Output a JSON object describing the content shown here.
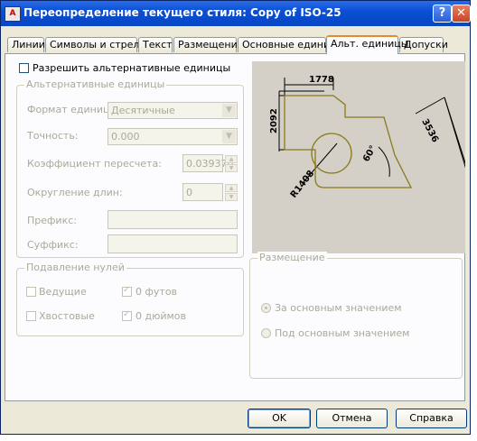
{
  "window": {
    "title": "Переопределение текущего стиля: Copy of ISO-25",
    "help_label": "?",
    "close_label": "✕"
  },
  "tabs": [
    {
      "label": "Линии",
      "active": false
    },
    {
      "label": "Символы и стрелки",
      "active": false
    },
    {
      "label": "Текст",
      "active": false
    },
    {
      "label": "Размещение",
      "active": false
    },
    {
      "label": "Основные единицы",
      "active": false
    },
    {
      "label": "Альт. единицы",
      "active": true
    },
    {
      "label": "Допуски",
      "active": false
    }
  ],
  "enable_alt": {
    "label": "Разрешить альтернативные единицы",
    "checked": false
  },
  "alt_units": {
    "title": "Альтернативные единицы",
    "format_label": "Формат единиц:",
    "format_value": "Десятичные",
    "precision_label": "Точность:",
    "precision_value": "0.000",
    "multiplier_label": "Коэффициент пересчета:",
    "multiplier_value": "0.039370",
    "round_label": "Округление длин:",
    "round_value": "0",
    "prefix_label": "Префикс:",
    "prefix_value": "",
    "suffix_label": "Суффикс:",
    "suffix_value": ""
  },
  "zero_suppression": {
    "title": "Подавление нулей",
    "leading": {
      "label": "Ведущие",
      "checked": false
    },
    "trailing": {
      "label": "Хвостовые",
      "checked": false
    },
    "feet": {
      "label": "0 футов",
      "checked": true
    },
    "inches": {
      "label": "0 дюймов",
      "checked": true
    }
  },
  "placement": {
    "title": "Размещение",
    "after": {
      "label": "За основным значением",
      "selected": true
    },
    "below": {
      "label": "Под основным значением",
      "selected": false
    }
  },
  "preview": {
    "dim_top": "1778",
    "dim_left": "2092",
    "dim_right": "3536",
    "dim_angle": "60°",
    "dim_radius": "R1408"
  },
  "buttons": {
    "ok": "OK",
    "cancel": "Отмена",
    "help": "Справка"
  },
  "colors": {
    "title_bar": "#0a4fd4",
    "group_title": "#0046d5",
    "active_tab_accent": "#e68b2c",
    "preview_bg": "#d4d0c8",
    "preview_shape": "#8a7a1a"
  }
}
